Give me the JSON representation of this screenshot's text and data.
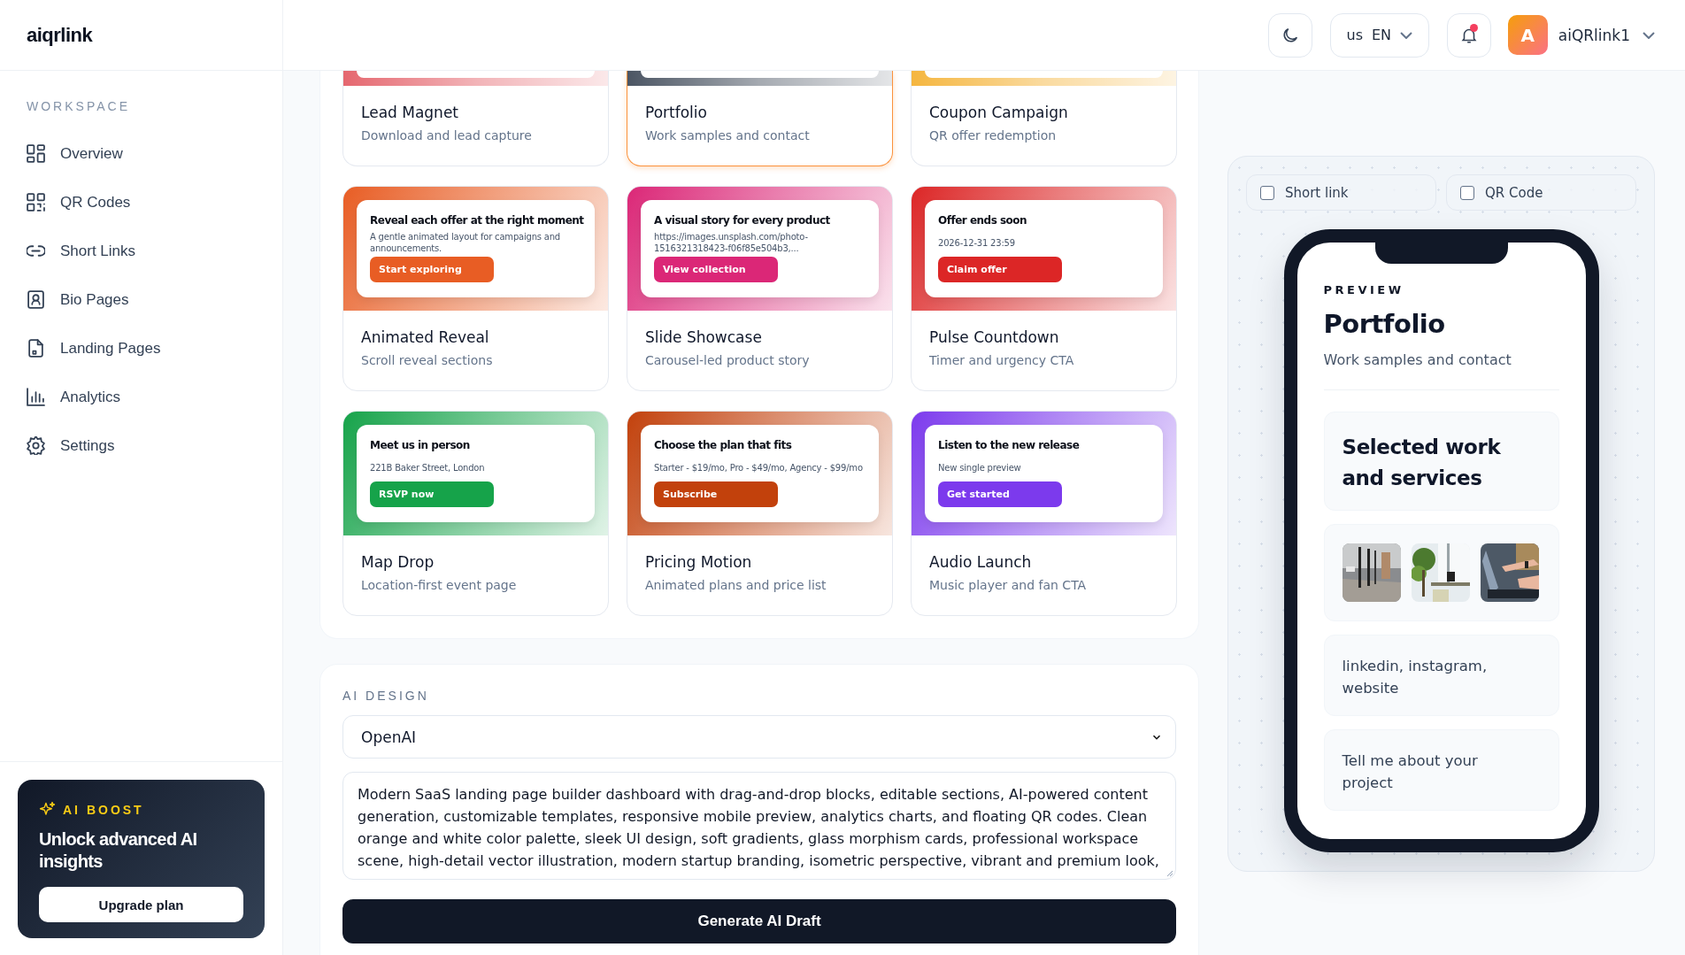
{
  "brand": {
    "logo": "aiqrlink"
  },
  "sidebar": {
    "section": "WORKSPACE",
    "items": [
      {
        "label": "Overview",
        "selected": false
      },
      {
        "label": "QR Codes",
        "selected": false
      },
      {
        "label": "Short Links",
        "selected": false
      },
      {
        "label": "Bio Pages",
        "selected": false
      },
      {
        "label": "Landing Pages",
        "selected": false
      },
      {
        "label": "Analytics",
        "selected": false
      },
      {
        "label": "Settings",
        "selected": false
      }
    ],
    "promo": {
      "label": "AI BOOST",
      "title": "Unlock advanced AI insights",
      "button": "Upgrade plan"
    }
  },
  "header": {
    "language": {
      "flag": "us",
      "code": "EN"
    },
    "notifications": {
      "unread": true
    },
    "user": {
      "initial": "A",
      "name": "aiQRlink1"
    }
  },
  "templates": [
    {
      "title": "Lead Magnet",
      "description": "Download and lead capture",
      "selected": false,
      "color": "#e5676f"
    },
    {
      "title": "Portfolio",
      "description": "Work samples and contact",
      "selected": true,
      "color": "#4b5563"
    },
    {
      "title": "Coupon Campaign",
      "description": "QR offer redemption",
      "selected": false,
      "color": "#f5b63f"
    },
    {
      "title": "Animated Reveal",
      "description": "Scroll reveal sections",
      "selected": false,
      "color": "#e85d24",
      "preview": {
        "headline": "Reveal each offer at the right moment",
        "text": "A gentle animated layout for campaigns and announcements.",
        "button": "Start exploring"
      }
    },
    {
      "title": "Slide Showcase",
      "description": "Carousel-led product story",
      "selected": false,
      "color": "#db2777",
      "preview": {
        "headline": "A visual story for every product",
        "text": "https://images.unsplash.com/photo-1516321318423-f06f85e504b3,...",
        "button": "View collection"
      }
    },
    {
      "title": "Pulse Countdown",
      "description": "Timer and urgency CTA",
      "selected": false,
      "color": "#dc2626",
      "preview": {
        "headline": "Offer ends soon",
        "text": "2026-12-31 23:59",
        "button": "Claim offer"
      }
    },
    {
      "title": "Map Drop",
      "description": "Location-first event page",
      "selected": false,
      "color": "#16a34a",
      "preview": {
        "headline": "Meet us in person",
        "text": "221B Baker Street, London",
        "button": "RSVP now"
      }
    },
    {
      "title": "Pricing Motion",
      "description": "Animated plans and price list",
      "selected": false,
      "color": "#c2410c",
      "preview": {
        "headline": "Choose the plan that fits",
        "text": "Starter - $19/mo, Pro - $49/mo, Agency - $99/mo",
        "button": "Subscribe"
      }
    },
    {
      "title": "Audio Launch",
      "description": "Music player and fan CTA",
      "selected": false,
      "color": "#7c3aed",
      "preview": {
        "headline": "Listen to the new release",
        "text": "New single preview",
        "button": "Get started"
      }
    }
  ],
  "ai_design": {
    "label": "AI DESIGN",
    "provider": "OpenAI",
    "prompt": "Modern SaaS landing page builder dashboard with drag-and-drop blocks, editable sections, AI-powered content generation, customizable templates, responsive mobile preview, analytics charts, and floating QR codes. Clean orange and white color palette, sleek UI design, soft gradients, glass morphism cards, professional workspace scene, high-detail vector illustration, modern startup branding, isometric perspective, vibrant and premium look,",
    "button": "Generate AI Draft"
  },
  "options": [
    {
      "label": "Short link",
      "checked": false
    },
    {
      "label": "QR Code",
      "checked": false
    }
  ],
  "preview": {
    "label": "PREVIEW",
    "title": "Portfolio",
    "subtitle": "Work samples and contact",
    "blocks": [
      {
        "kind": "heading",
        "text": "Selected work and services"
      },
      {
        "kind": "gallery"
      },
      {
        "kind": "text",
        "text": "linkedin, instagram, website"
      },
      {
        "kind": "text",
        "text": "Tell me about your project"
      }
    ]
  }
}
